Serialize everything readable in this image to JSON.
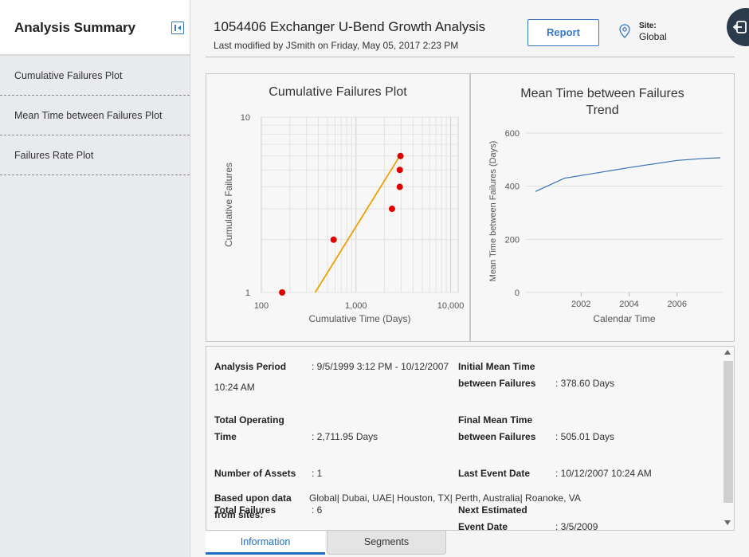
{
  "sidebar": {
    "title": "Analysis Summary",
    "items": [
      {
        "label": "Cumulative Failures Plot"
      },
      {
        "label": "Mean Time between Failures Plot"
      },
      {
        "label": "Failures Rate Plot"
      }
    ]
  },
  "header": {
    "title": "1054406 Exchanger U-Bend Growth Analysis",
    "subtitle": "Last modified by JSmith on Friday, May 05, 2017 2:23 PM",
    "report_label": "Report",
    "site_label": "Site:",
    "site_value": "Global"
  },
  "chart_data": [
    {
      "type": "scatter",
      "title": "Cumulative Failures Plot",
      "xlabel": "Cumulative Time (Days)",
      "ylabel": "Cumulative Failures",
      "xscale": "log",
      "yscale": "log",
      "xlim": [
        100,
        12000
      ],
      "ylim": [
        1,
        10
      ],
      "x_ticks": [
        "100",
        "1,000",
        "10,000"
      ],
      "y_ticks": [
        "10",
        "1"
      ],
      "grid": true,
      "series": [
        {
          "values": [
            [
              166,
              1
            ],
            [
              580,
              2
            ],
            [
              2400,
              3
            ],
            [
              2900,
              4
            ],
            [
              2900,
              5
            ],
            [
              2950,
              6
            ]
          ],
          "color": "#e00000"
        },
        {
          "fit_line": [
            [
              370,
              1
            ],
            [
              2900,
              6
            ]
          ],
          "color": "#f0a000"
        }
      ]
    },
    {
      "type": "line",
      "title": "Mean Time between Failures Trend",
      "xlabel": "Calendar Time",
      "ylabel": "Mean Time between Failures (Days)",
      "xlim": [
        1999.7,
        2007.9
      ],
      "ylim": [
        0,
        600
      ],
      "x_ticks": [
        "2002",
        "2004",
        "2006"
      ],
      "y_ticks": [
        "600",
        "400",
        "200",
        "0"
      ],
      "grid": true,
      "series": [
        {
          "values": [
            [
              2000.1,
              380
            ],
            [
              2001.3,
              430
            ],
            [
              2004.0,
              470
            ],
            [
              2006.0,
              497
            ],
            [
              2007.2,
              505
            ],
            [
              2007.8,
              507
            ]
          ],
          "color": "#3a6fb5"
        }
      ]
    }
  ],
  "info": {
    "analysis_period_label": "Analysis Period",
    "analysis_period_value": ": 9/5/1999 3:12 PM - 10/12/2007",
    "analysis_period_value2": "10:24 AM",
    "initial_mtbf_label1": "Initial Mean Time",
    "initial_mtbf_label2": "between Failures",
    "initial_mtbf_value": ": 378.60 Days",
    "total_op_label1": "Total Operating",
    "total_op_label2": "Time",
    "total_op_value": ": 2,711.95 Days",
    "final_mtbf_label1": "Final Mean Time",
    "final_mtbf_label2": "between Failures",
    "final_mtbf_value": ": 505.01 Days",
    "num_assets_label": "Number of Assets",
    "num_assets_value": ": 1",
    "last_event_label": "Last Event Date",
    "last_event_value": ": 10/12/2007 10:24 AM",
    "based_label1": "Based upon data",
    "based_label2": "from sites:",
    "based_value": "Global| Dubai, UAE| Houston, TX| Perth, Australia| Roanoke, VA",
    "total_failures_label": "Total Failures",
    "total_failures_value": ": 6",
    "next_est_label1": "Next Estimated",
    "next_est_label2": "Event Date",
    "next_est_value": ": 3/5/2009"
  },
  "tabs": [
    {
      "label": "Information",
      "active": true
    },
    {
      "label": "Segments",
      "active": false
    }
  ],
  "colors": {
    "accent": "#1e6fbf",
    "failure_points": "#e00000",
    "fit_line": "#f0a000",
    "trend_line": "#3a6fb5"
  }
}
